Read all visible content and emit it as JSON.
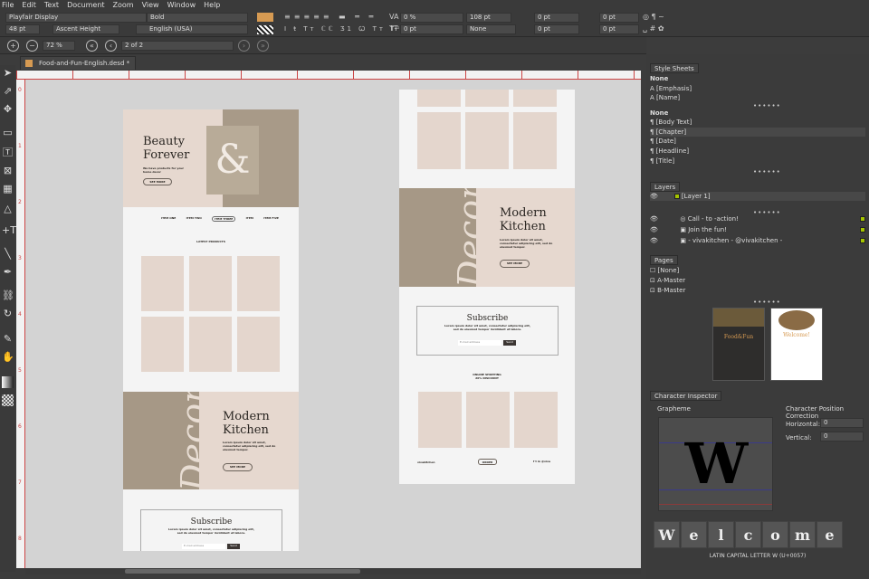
{
  "menu": [
    "File",
    "Edit",
    "Text",
    "Document",
    "Zoom",
    "View",
    "Window",
    "Help"
  ],
  "props": {
    "font": "Playfair Display",
    "style": "Bold",
    "size": "48 pt",
    "baseline": "Ascent Height",
    "language": "English (USA)",
    "tracking": "0 %",
    "scaling": "0 pt",
    "line_spacing": "108 pt",
    "line_mode": "None",
    "space_before": "0 pt",
    "space_after": "0 pt",
    "indent_first": "0 pt",
    "indent_left": "0 pt",
    "fill_color": "#d69a52"
  },
  "nav": {
    "zoom": "72 %",
    "page": "2 of 2"
  },
  "document_tab": "Food-and-Fun-English.desd *",
  "ruler": {
    "v": [
      "0",
      "1",
      "2",
      "3",
      "4",
      "5",
      "6",
      "7",
      "8"
    ]
  },
  "page1": {
    "hero_title_1": "Beauty",
    "hero_title_2": "Forever",
    "hero_sub": "We have products for your home decor",
    "hero_btn": "SEE MORE",
    "ampersand": "&",
    "tabs": [
      "ITEM ONE",
      "ITEM TWO",
      "ITEM THREE",
      "ITEM",
      "ITEM FIVE"
    ],
    "latest": "LATEST PRODUCTS",
    "decor": "Decor",
    "kitchen_1": "Modern",
    "kitchen_2": "Kitchen",
    "kitchen_body": "Lorem ipsum dolor sit amet, consectetur adipiscing elit, sed do eiusmod tempor.",
    "kitchen_btn": "SEE MORE",
    "subscribe": "Subscribe",
    "subscribe_body": "Lorem ipsum dolor sit amet, consectetur adipiscing elit, sed do eiusmod tempor incididunt ut labore.",
    "email_placeholder": "E-mail address",
    "send": "Send"
  },
  "page2": {
    "decor": "Decor",
    "kitchen_1": "Modern",
    "kitchen_2": "Kitchen",
    "kitchen_body": "Lorem ipsum dolor sit amet, consectetur adipiscing elit, sed do eiusmod tempor.",
    "kitchen_btn": "SEE MORE",
    "subscribe": "Subscribe",
    "subscribe_body": "Lorem ipsum dolor sit amet, consectetur adipiscing elit, sed do eiusmod tempor incididunt ut labore.",
    "email_placeholder": "E-mail address",
    "send": "Send",
    "shop_1": "ONLINE SHOPPING",
    "shop_2": "20% DISCOUNT",
    "footer_left": "vivakitchen",
    "footer_btn": "ORDER",
    "footer_right": "f t in  @viva"
  },
  "panel": {
    "style_sheets_tab": "Style Sheets",
    "char_styles": [
      "None",
      "[Emphasis]",
      "[Name]"
    ],
    "para_styles": [
      "None",
      "[Body Text]",
      "[Chapter]",
      "[Date]",
      "[Headline]",
      "[Title]"
    ],
    "layers_tab": "Layers",
    "layer": "[Layer 1]",
    "objects": [
      "Call - to -action!",
      "Join the fun!",
      "- vivakitchen -  @vivakitchen -"
    ],
    "pages_tab": "Pages",
    "masters": [
      "[None]",
      "A-Master",
      "B-Master"
    ],
    "thumb1_title": "Food&Fun",
    "thumb2_title": "Welcome!",
    "char_inspector_tab": "Character Inspector",
    "grapheme_label": "Grapheme",
    "grapheme": "W",
    "position_label": "Character Position Correction",
    "horizontal_label": "Horizontal:",
    "horizontal": "0",
    "vertical_label": "Vertical:",
    "vertical": "0",
    "letters": [
      "W",
      "e",
      "l",
      "c",
      "o",
      "m",
      "e"
    ],
    "char_name": "LATIN CAPITAL LETTER W (U+0057)"
  }
}
